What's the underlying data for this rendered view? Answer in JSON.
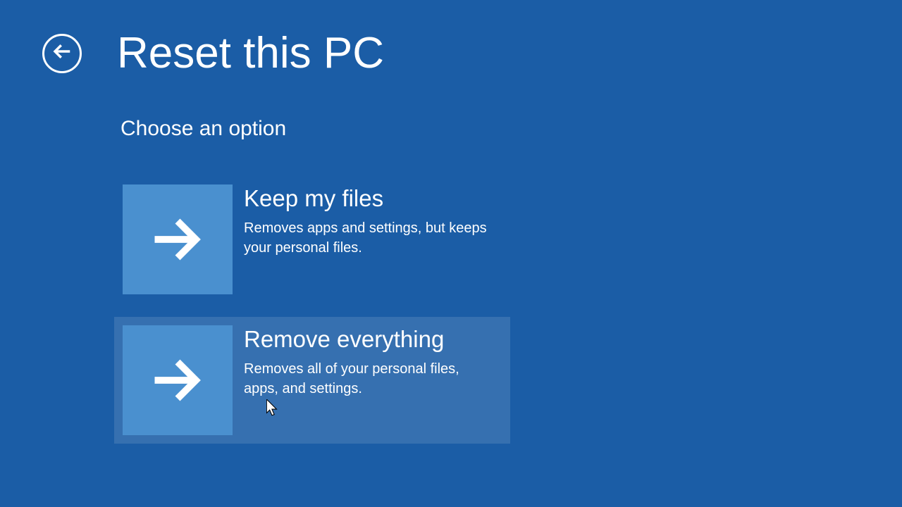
{
  "header": {
    "title": "Reset this PC"
  },
  "subtitle": "Choose an option",
  "options": [
    {
      "title": "Keep my files",
      "description": "Removes apps and settings, but keeps your personal files."
    },
    {
      "title": "Remove everything",
      "description": "Removes all of your personal files, apps, and settings."
    }
  ]
}
